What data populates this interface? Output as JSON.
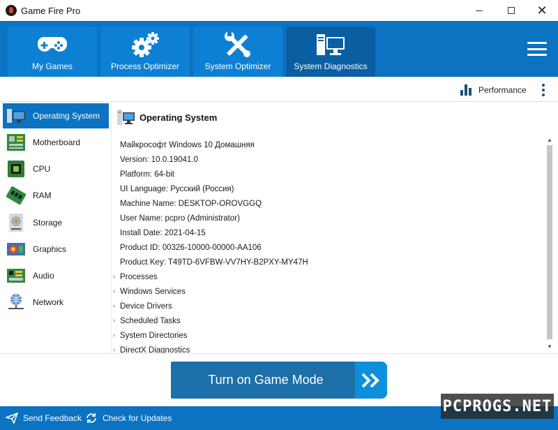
{
  "window": {
    "title": "Game Fire Pro",
    "minimize_icon": "minimize-icon",
    "maximize_icon": "maximize-icon",
    "close_icon": "close-icon"
  },
  "tabs": [
    {
      "label": "My Games",
      "icon": "gamepad-icon"
    },
    {
      "label": "Process Optimizer",
      "icon": "gears-icon"
    },
    {
      "label": "System Optimizer",
      "icon": "tools-icon"
    },
    {
      "label": "System Diagnostics",
      "icon": "computer-icon",
      "active": true
    }
  ],
  "toolbar": {
    "performance_label": "Performance"
  },
  "sidebar": {
    "items": [
      {
        "label": "Operating System",
        "icon": "computer-icon",
        "active": true
      },
      {
        "label": "Motherboard",
        "icon": "motherboard-icon"
      },
      {
        "label": "CPU",
        "icon": "cpu-icon"
      },
      {
        "label": "RAM",
        "icon": "ram-icon"
      },
      {
        "label": "Storage",
        "icon": "hard-drive-icon"
      },
      {
        "label": "Graphics",
        "icon": "graphics-card-icon"
      },
      {
        "label": "Audio",
        "icon": "sound-card-icon"
      },
      {
        "label": "Network",
        "icon": "network-icon"
      }
    ]
  },
  "main": {
    "heading": "Operating System",
    "info": [
      "Майкрософт Windows 10 Домашняя",
      "Version: 10.0.19041.0",
      "Platform: 64-bit",
      "UI Language: Русский (Россия)",
      "Machine Name: DESKTOP-OROVGGQ",
      "User Name: pcpro (Administrator)",
      "Install Date: 2021-04-15",
      "Product ID: 00326-10000-00000-AA106",
      "Product Key: T49TD-6VFBW-VV7HY-B2PXY-MY47H"
    ],
    "sections": [
      "Processes",
      "Windows Services",
      "Device Drivers",
      "Scheduled Tasks",
      "System Directories",
      "DirectX Diagnostics"
    ]
  },
  "action": {
    "game_mode_label": "Turn on Game Mode"
  },
  "statusbar": {
    "feedback_label": "Send Feedback",
    "updates_label": "Check for Updates"
  },
  "watermark": "PCPROGS.NET",
  "colors": {
    "brand_blue": "#0b73c1",
    "active_tab": "#0a5fa2",
    "button_blue": "#1c6fa8",
    "arrow_blue": "#0e8fdc"
  }
}
